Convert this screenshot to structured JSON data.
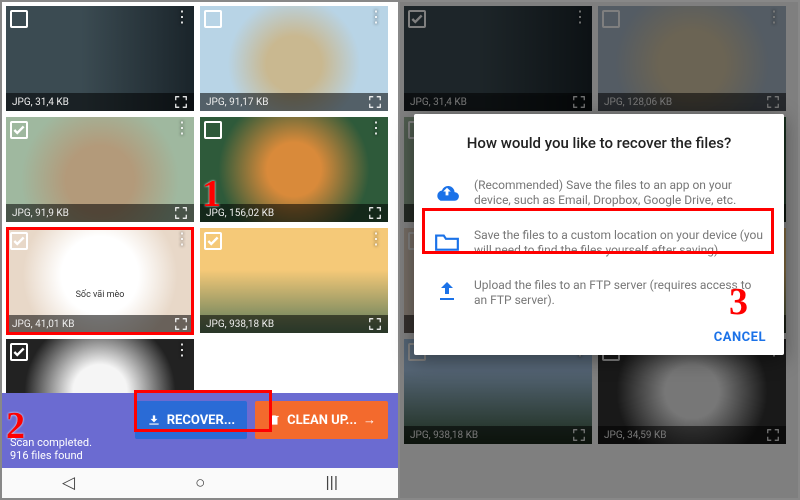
{
  "left": {
    "thumbs": [
      {
        "size": "JPG, 31,4 KB",
        "checked": false,
        "cls": "th0"
      },
      {
        "size": "JPG, 91,17 KB",
        "checked": false,
        "cls": "th1"
      },
      {
        "size": "JPG, 91,9 KB",
        "checked": true,
        "cls": "th2"
      },
      {
        "size": "JPG, 156,02 KB",
        "checked": false,
        "cls": "th3"
      },
      {
        "size": "JPG, 41,01 KB",
        "checked": true,
        "cls": "th4",
        "caption": "Sốc vãi mèo"
      },
      {
        "size": "JPG, 938,18 KB",
        "checked": true,
        "cls": "th5"
      },
      {
        "size": "",
        "checked": true,
        "cls": "th6"
      }
    ],
    "recover_label": "RECOVER...",
    "clean_label": "CLEAN UP...",
    "status_line1": "Scan completed.",
    "status_line2": "916 files found"
  },
  "right": {
    "thumbs_bg": [
      {
        "size": "JPG, 31,4 KB",
        "checked": true,
        "cls": "th0"
      },
      {
        "size": "JPG, 128,06 KB",
        "checked": false,
        "cls": "th7"
      },
      {
        "size": "",
        "checked": false,
        "cls": "th2"
      },
      {
        "size": "",
        "checked": false,
        "cls": "th3"
      },
      {
        "size": "",
        "checked": false,
        "cls": "th4"
      },
      {
        "size": "",
        "checked": false,
        "cls": "th5"
      },
      {
        "size": "JPG, 938,18 KB",
        "checked": false,
        "cls": "th8"
      },
      {
        "size": "JPG, 34,59 KB",
        "checked": false,
        "cls": "th9"
      }
    ],
    "dialog": {
      "title": "How would you like to recover the files?",
      "opt1": "(Recommended) Save the files to an app on your device, such as Email, Dropbox, Google Drive, etc.",
      "opt2": "Save the files to a custom location on your device (you will need to find the files yourself after saving).",
      "opt3": "Upload the files to an FTP server (requires access to an FTP server).",
      "cancel": "CANCEL"
    }
  },
  "annot": {
    "a1": "1",
    "a2": "2",
    "a3": "3"
  }
}
